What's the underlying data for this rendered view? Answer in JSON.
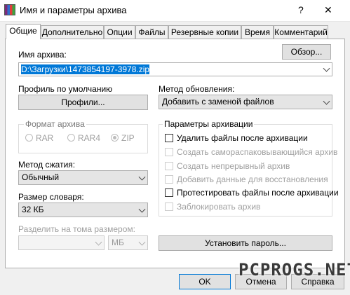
{
  "window": {
    "title": "Имя и параметры архива",
    "help_glyph": "?",
    "close_glyph": "✕"
  },
  "tabs": [
    "Общие",
    "Дополнительно",
    "Опции",
    "Файлы",
    "Резервные копии",
    "Время",
    "Комментарий"
  ],
  "general": {
    "archive_name_label": "Имя архива:",
    "browse_button": "Обзор...",
    "archive_name_value": "D:\\Загрузки\\1473854197-3978.zip",
    "default_profile_label": "Профиль по умолчанию",
    "profiles_button": "Профили...",
    "update_method_label": "Метод обновления:",
    "update_method_value": "Добавить с заменой файлов",
    "archive_format": {
      "label": "Формат архива",
      "options": [
        "RAR",
        "RAR4",
        "ZIP"
      ],
      "selected": "ZIP"
    },
    "compression_label": "Метод сжатия:",
    "compression_value": "Обычный",
    "dictionary_label": "Размер словаря:",
    "dictionary_value": "32 КБ",
    "split_label": "Разделить на тома размером:",
    "split_value": "",
    "split_unit": "МБ",
    "archive_options": {
      "label": "Параметры архивации",
      "items": [
        {
          "label": "Удалить файлы после архивации",
          "checked": false,
          "enabled": true
        },
        {
          "label": "Создать самораспаковывающийся архив",
          "checked": false,
          "enabled": false
        },
        {
          "label": "Создать непрерывный архив",
          "checked": false,
          "enabled": false
        },
        {
          "label": "Добавить данные для восстановления",
          "checked": false,
          "enabled": false
        },
        {
          "label": "Протестировать файлы после архивации",
          "checked": false,
          "enabled": true
        },
        {
          "label": "Заблокировать архив",
          "checked": false,
          "enabled": false
        }
      ]
    },
    "set_password_button": "Установить пароль..."
  },
  "footer": {
    "ok": "OK",
    "cancel": "Отмена",
    "help": "Справка"
  },
  "watermark": "PCPROGS.NET"
}
